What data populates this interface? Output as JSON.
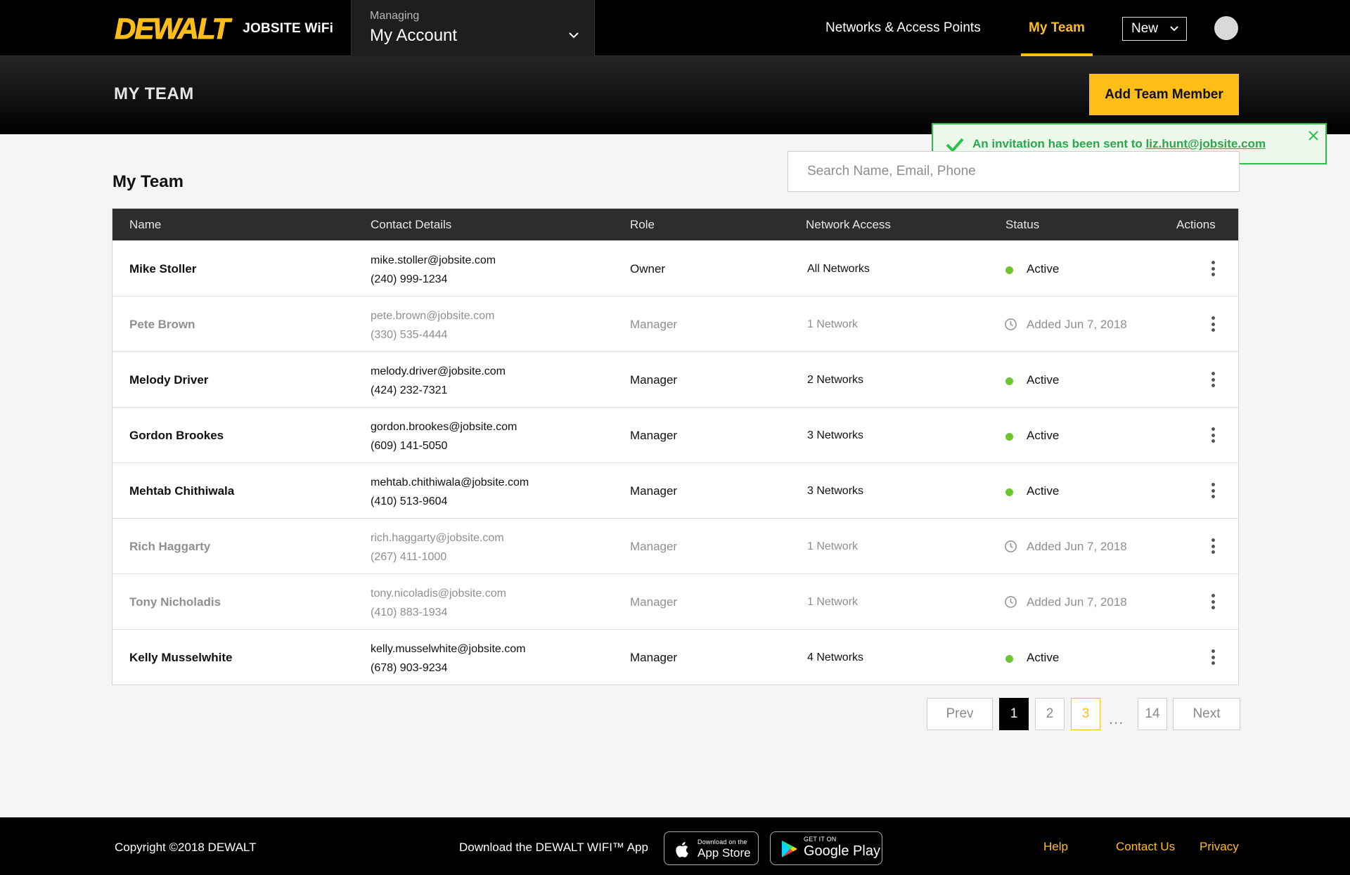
{
  "brand": {
    "logo": "DEWALT",
    "product": "JOBSITE WiFi"
  },
  "managing": {
    "label": "Managing",
    "value": "My Account"
  },
  "nav": {
    "networks": "Networks & Access Points",
    "my_team": "My Team",
    "new": "New"
  },
  "page_header": {
    "title": "MY TEAM",
    "add_button": "Add Team Member"
  },
  "toast": {
    "prefix": "An invitation has been sent to ",
    "email": "liz.hunt@jobsite.com"
  },
  "section": {
    "title": "My Team"
  },
  "search": {
    "placeholder": "Search Name, Email, Phone"
  },
  "table": {
    "columns": [
      "Name",
      "Contact Details",
      "Role",
      "Network Access",
      "Status",
      "Actions"
    ],
    "rows": [
      {
        "name": "Mike Stoller",
        "email": "mike.stoller@jobsite.com",
        "phone": "(240) 999-1234",
        "role": "Owner",
        "network": "All Networks",
        "status": "Active",
        "state": "active"
      },
      {
        "name": "Pete Brown",
        "email": "pete.brown@jobsite.com",
        "phone": "(330) 535-4444",
        "role": "Manager",
        "network": "1 Network",
        "status": "Added Jun 7, 2018",
        "state": "pending"
      },
      {
        "name": "Melody Driver",
        "email": "melody.driver@jobsite.com",
        "phone": "(424) 232-7321",
        "role": "Manager",
        "network": "2 Networks",
        "status": "Active",
        "state": "active"
      },
      {
        "name": "Gordon Brookes",
        "email": "gordon.brookes@jobsite.com",
        "phone": "(609) 141-5050",
        "role": "Manager",
        "network": "3 Networks",
        "status": "Active",
        "state": "active"
      },
      {
        "name": "Mehtab Chithiwala",
        "email": "mehtab.chithiwala@jobsite.com",
        "phone": "(410) 513-9604",
        "role": "Manager",
        "network": "3 Networks",
        "status": "Active",
        "state": "active"
      },
      {
        "name": "Rich Haggarty",
        "email": "rich.haggarty@jobsite.com",
        "phone": "(267) 411-1000",
        "role": "Manager",
        "network": "1 Network",
        "status": "Added Jun 7, 2018",
        "state": "pending"
      },
      {
        "name": "Tony Nicholadis",
        "email": "tony.nicoladis@jobsite.com",
        "phone": "(410) 883-1934",
        "role": "Manager",
        "network": "1 Network",
        "status": "Added Jun 7, 2018",
        "state": "pending"
      },
      {
        "name": "Kelly Musselwhite",
        "email": "kelly.musselwhite@jobsite.com",
        "phone": "(678) 903-9234",
        "role": "Manager",
        "network": "4 Networks",
        "status": "Active",
        "state": "active"
      }
    ]
  },
  "pagination": {
    "prev": "Prev",
    "pages": [
      "1",
      "2",
      "3"
    ],
    "ellipsis": "...",
    "last": "14",
    "next": "Next",
    "current": "1"
  },
  "footer": {
    "copyright": "Copyright ©2018 DEWALT",
    "download_text": "Download the DEWALT WIFI™ App",
    "app_store": {
      "small": "Download on the",
      "big": "App Store"
    },
    "google_play": {
      "small": "GET IT ON",
      "big": "Google Play"
    },
    "links": {
      "help": "Help",
      "contact": "Contact Us",
      "privacy": "Privacy"
    }
  },
  "colors": {
    "accent": "#febd17",
    "success": "#2fbf4b",
    "active_dot": "#6cc531",
    "header_bg": "#000000",
    "table_head": "#2d2d2d"
  }
}
